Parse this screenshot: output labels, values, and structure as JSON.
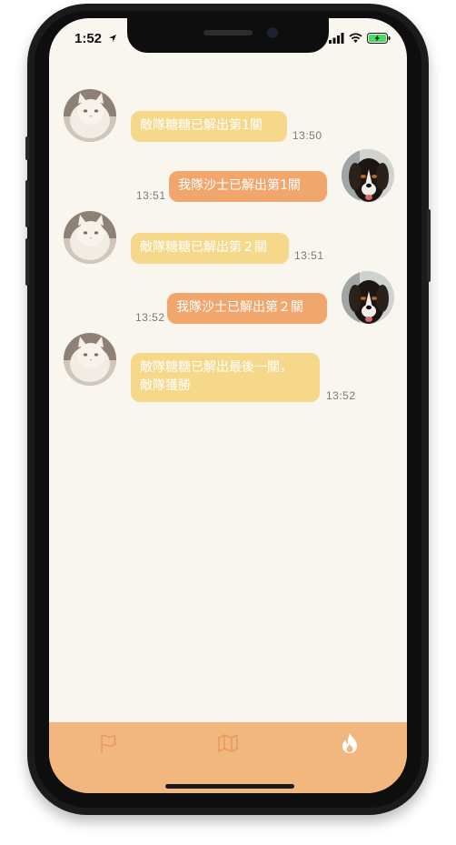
{
  "status_bar": {
    "time": "1:52",
    "location_icon": "location-arrow-icon",
    "signal_icon": "cellular-signal-icon",
    "wifi_icon": "wifi-icon",
    "battery_icon": "battery-charging-icon",
    "battery_color": "#4cd964"
  },
  "chat": {
    "messages": [
      {
        "side": "left",
        "avatar": "cat-avatar",
        "text": "敵隊糖糖已解出第1關",
        "time": "13:50"
      },
      {
        "side": "right",
        "avatar": "dog-avatar",
        "text": "我隊沙士已解出第1關",
        "time": "13:51"
      },
      {
        "side": "left",
        "avatar": "cat-avatar",
        "text": "敵隊糖糖已解出第２關",
        "time": "13:51"
      },
      {
        "side": "right",
        "avatar": "dog-avatar",
        "text": "我隊沙士已解出第２關",
        "time": "13:52"
      },
      {
        "side": "left",
        "avatar": "cat-avatar",
        "lines": [
          "敵隊糖糖已解出最後一關，",
          "敵隊獲勝"
        ],
        "time": "13:52"
      }
    ]
  },
  "tabbar": {
    "tabs": [
      {
        "icon": "flag-icon",
        "active": false
      },
      {
        "icon": "map-icon",
        "active": false
      },
      {
        "icon": "flame-icon",
        "active": true
      }
    ],
    "background": "#f2b77f"
  },
  "colors": {
    "enemy_bubble": "#f6d88a",
    "team_bubble": "#f0a66c",
    "screen_bg": "#f9f5ef"
  }
}
